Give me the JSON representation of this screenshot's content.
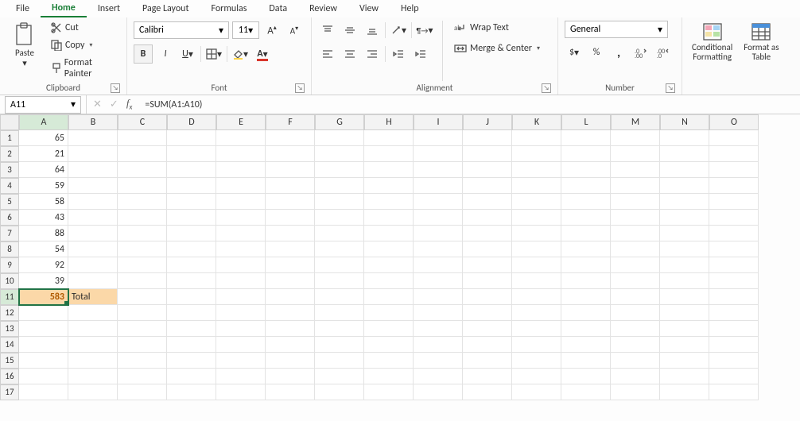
{
  "menu": {
    "items": [
      "File",
      "Home",
      "Insert",
      "Page Layout",
      "Formulas",
      "Data",
      "Review",
      "View",
      "Help"
    ],
    "active": "Home"
  },
  "ribbon": {
    "clipboard": {
      "label": "Clipboard",
      "paste": "Paste",
      "cut": "Cut",
      "copy": "Copy",
      "format_painter": "Format Painter"
    },
    "font": {
      "label": "Font",
      "name": "Calibri",
      "size": "11",
      "bold": "B",
      "italic": "I",
      "underline": "U"
    },
    "alignment": {
      "label": "Alignment",
      "wrap_text": "Wrap Text",
      "merge_center": "Merge & Center"
    },
    "number": {
      "label": "Number",
      "format": "General",
      "percent": "%",
      "comma": ","
    },
    "styles": {
      "conditional_formatting": "Conditional\nFormatting",
      "format_as_table": "Format as\nTable"
    }
  },
  "name_box": "A11",
  "formula_bar": "=SUM(A1:A10)",
  "columns": [
    "A",
    "B",
    "C",
    "D",
    "E",
    "F",
    "G",
    "H",
    "I",
    "J",
    "K",
    "L",
    "M",
    "N",
    "O"
  ],
  "selected_col": "A",
  "row_count": 17,
  "selected_row": 11,
  "cells": {
    "A1": "65",
    "A2": "21",
    "A3": "64",
    "A4": "59",
    "A5": "58",
    "A6": "43",
    "A7": "88",
    "A8": "54",
    "A9": "92",
    "A10": "39",
    "A11": "583",
    "B11": "Total"
  },
  "active_cell": "A11",
  "highlighted": [
    "A11",
    "B11"
  ]
}
